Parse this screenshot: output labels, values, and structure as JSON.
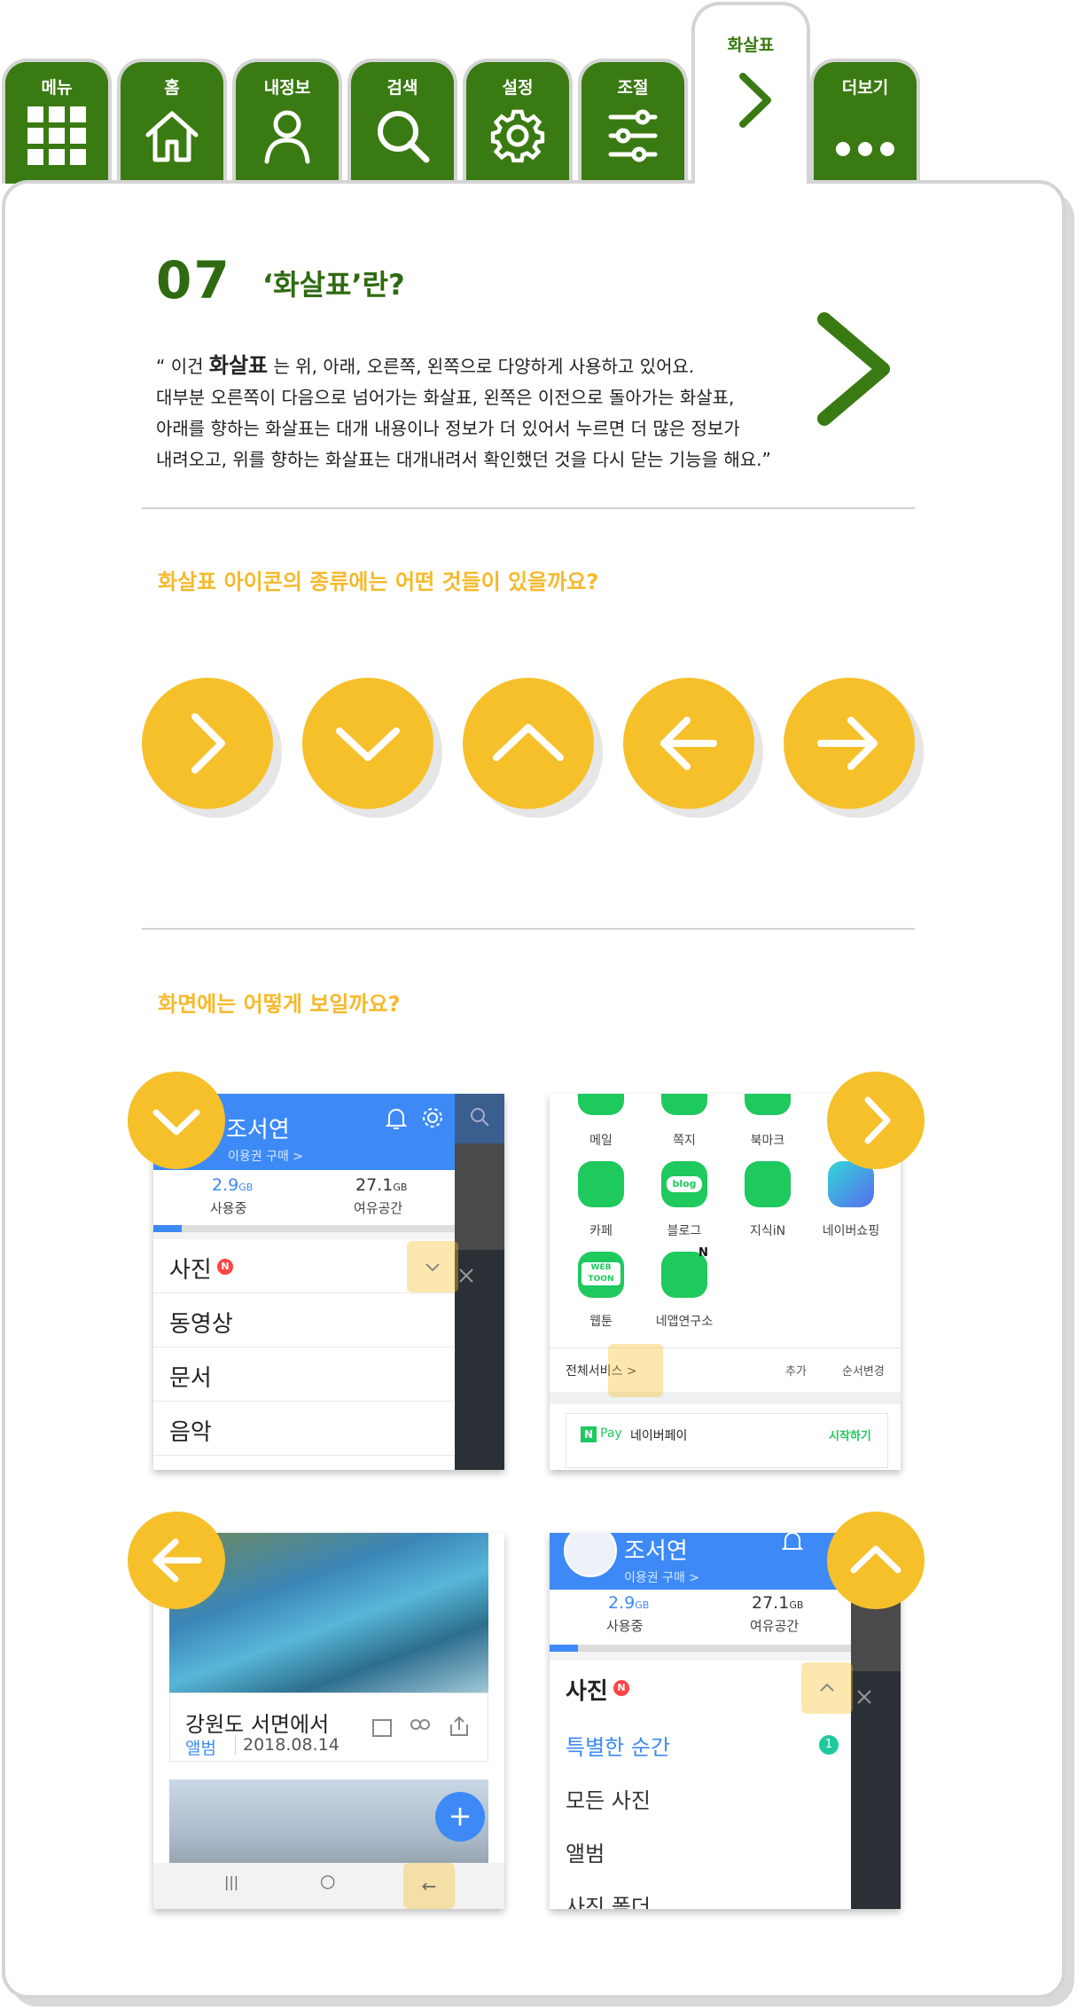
{
  "tabs": [
    {
      "label": "메뉴",
      "icon": "grid-icon"
    },
    {
      "label": "홈",
      "icon": "home-icon"
    },
    {
      "label": "내정보",
      "icon": "person-icon"
    },
    {
      "label": "검색",
      "icon": "search-icon"
    },
    {
      "label": "설정",
      "icon": "gear-icon"
    },
    {
      "label": "조절",
      "icon": "sliders-icon"
    },
    {
      "label": "화살표",
      "icon": "chevron-right-icon",
      "active": true
    },
    {
      "label": "더보기",
      "icon": "more-icon"
    }
  ],
  "section": {
    "number": "07",
    "title": "‘화살표’란?",
    "desc_prefix": "“ 이건 ",
    "desc_strong": "화살표",
    "desc_line1_rest": " 는 위, 아래, 오른쪽, 왼쪽으로 다양하게 사용하고 있어요.",
    "desc_line2": "대부분 오른쪽이 다음으로 넘어가는 화살표, 왼쪽은 이전으로 돌아가는 화살표,",
    "desc_line3": "아래를 향하는 화살표는 대개 내용이나 정보가 더 있어서 누르면 더 많은 정보가",
    "desc_line4": "내려오고, 위를 향하는 화살표는 대개내려서 확인했던 것을 다시 닫는 기능을 해요.”"
  },
  "question1": "화살표 아이콘의 종류에는 어떤 것들이 있을까요?",
  "arrow_types": [
    "chevron-right-icon",
    "chevron-down-icon",
    "chevron-up-icon",
    "arrow-left-icon",
    "arrow-right-icon"
  ],
  "question2": "화면에는 어떻게 보일까요?",
  "shot1": {
    "name": "조서연",
    "sub": "이용권 구매 >",
    "used_value": "2.9",
    "used_unit": "GB",
    "used_label": "사용중",
    "free_value": "27.1",
    "free_unit": "GB",
    "free_label": "여유공간",
    "rows": [
      "사진",
      "동영상",
      "문서",
      "음악"
    ],
    "new_badge": "N"
  },
  "shot2": {
    "top_labels": [
      "메일",
      "쪽지",
      "북마크"
    ],
    "apps": [
      "카페",
      "블로그",
      "지식iN",
      "네이버쇼핑",
      "웹툰",
      "네앱연구소"
    ],
    "blog_text": "blog",
    "webtoon_text": "WEB TOON",
    "all_services": "전체서비스 >",
    "add": "추가",
    "reorder": "순서변경",
    "pay_logo": "N",
    "pay_word": "Pay",
    "pay_name": "네이버페이",
    "pay_start": "시작하기",
    "new_badge": "N"
  },
  "shot3": {
    "caption": "강원도 서면에서",
    "album": "앨범",
    "date": "2018.08.14",
    "fab": "+",
    "nav": [
      "|||",
      "○",
      "←"
    ]
  },
  "shot4": {
    "name": "조서연",
    "sub": "이용권 구매 >",
    "used_value": "2.9",
    "used_unit": "GB",
    "used_label": "사용중",
    "free_value": "27.1",
    "free_unit": "GB",
    "free_label": "여유공간",
    "header": "사진",
    "new_badge": "N",
    "rows": [
      "특별한 순간",
      "모든 사진",
      "앨범",
      "사진 폴더"
    ],
    "count": "1"
  },
  "colors": {
    "tab_green": "#3a7a12",
    "title_green": "#2f6a10",
    "accent_yellow": "#f6c02b",
    "question_yellow": "#f6b92b",
    "naver_blue": "#3d8af7",
    "naver_green": "#1ec95d"
  }
}
